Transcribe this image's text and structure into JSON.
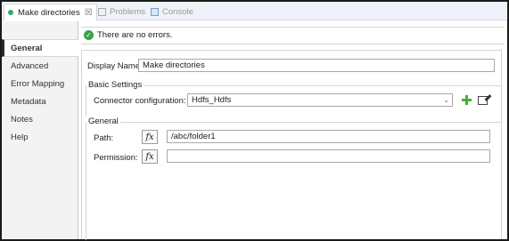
{
  "tabs": [
    {
      "label": "Make directories",
      "close": "☒"
    },
    {
      "label": "Problems"
    },
    {
      "label": "Console"
    }
  ],
  "sidebar": {
    "items": [
      {
        "label": "General"
      },
      {
        "label": "Advanced"
      },
      {
        "label": "Error Mapping"
      },
      {
        "label": "Metadata"
      },
      {
        "label": "Notes"
      },
      {
        "label": "Help"
      }
    ]
  },
  "status": {
    "text": "There are no errors."
  },
  "form": {
    "display_name_label": "Display Name:",
    "display_name_value": "Make directories",
    "basic_settings_title": "Basic Settings",
    "connector_label": "Connector configuration:",
    "connector_value": "Hdfs_Hdfs",
    "general_title": "General",
    "path_label": "Path:",
    "path_value": "/abc/folder1",
    "permission_label": "Permission:",
    "permission_value": "",
    "fx_label": "fx"
  },
  "colors": {
    "status_ok": "#3aa34a",
    "add_icon": "#4caf2f",
    "tabbar_bg": "#eef3f9"
  },
  "icons": {
    "status": "check-circle-icon",
    "add": "plus-icon",
    "edit": "edit-icon"
  }
}
